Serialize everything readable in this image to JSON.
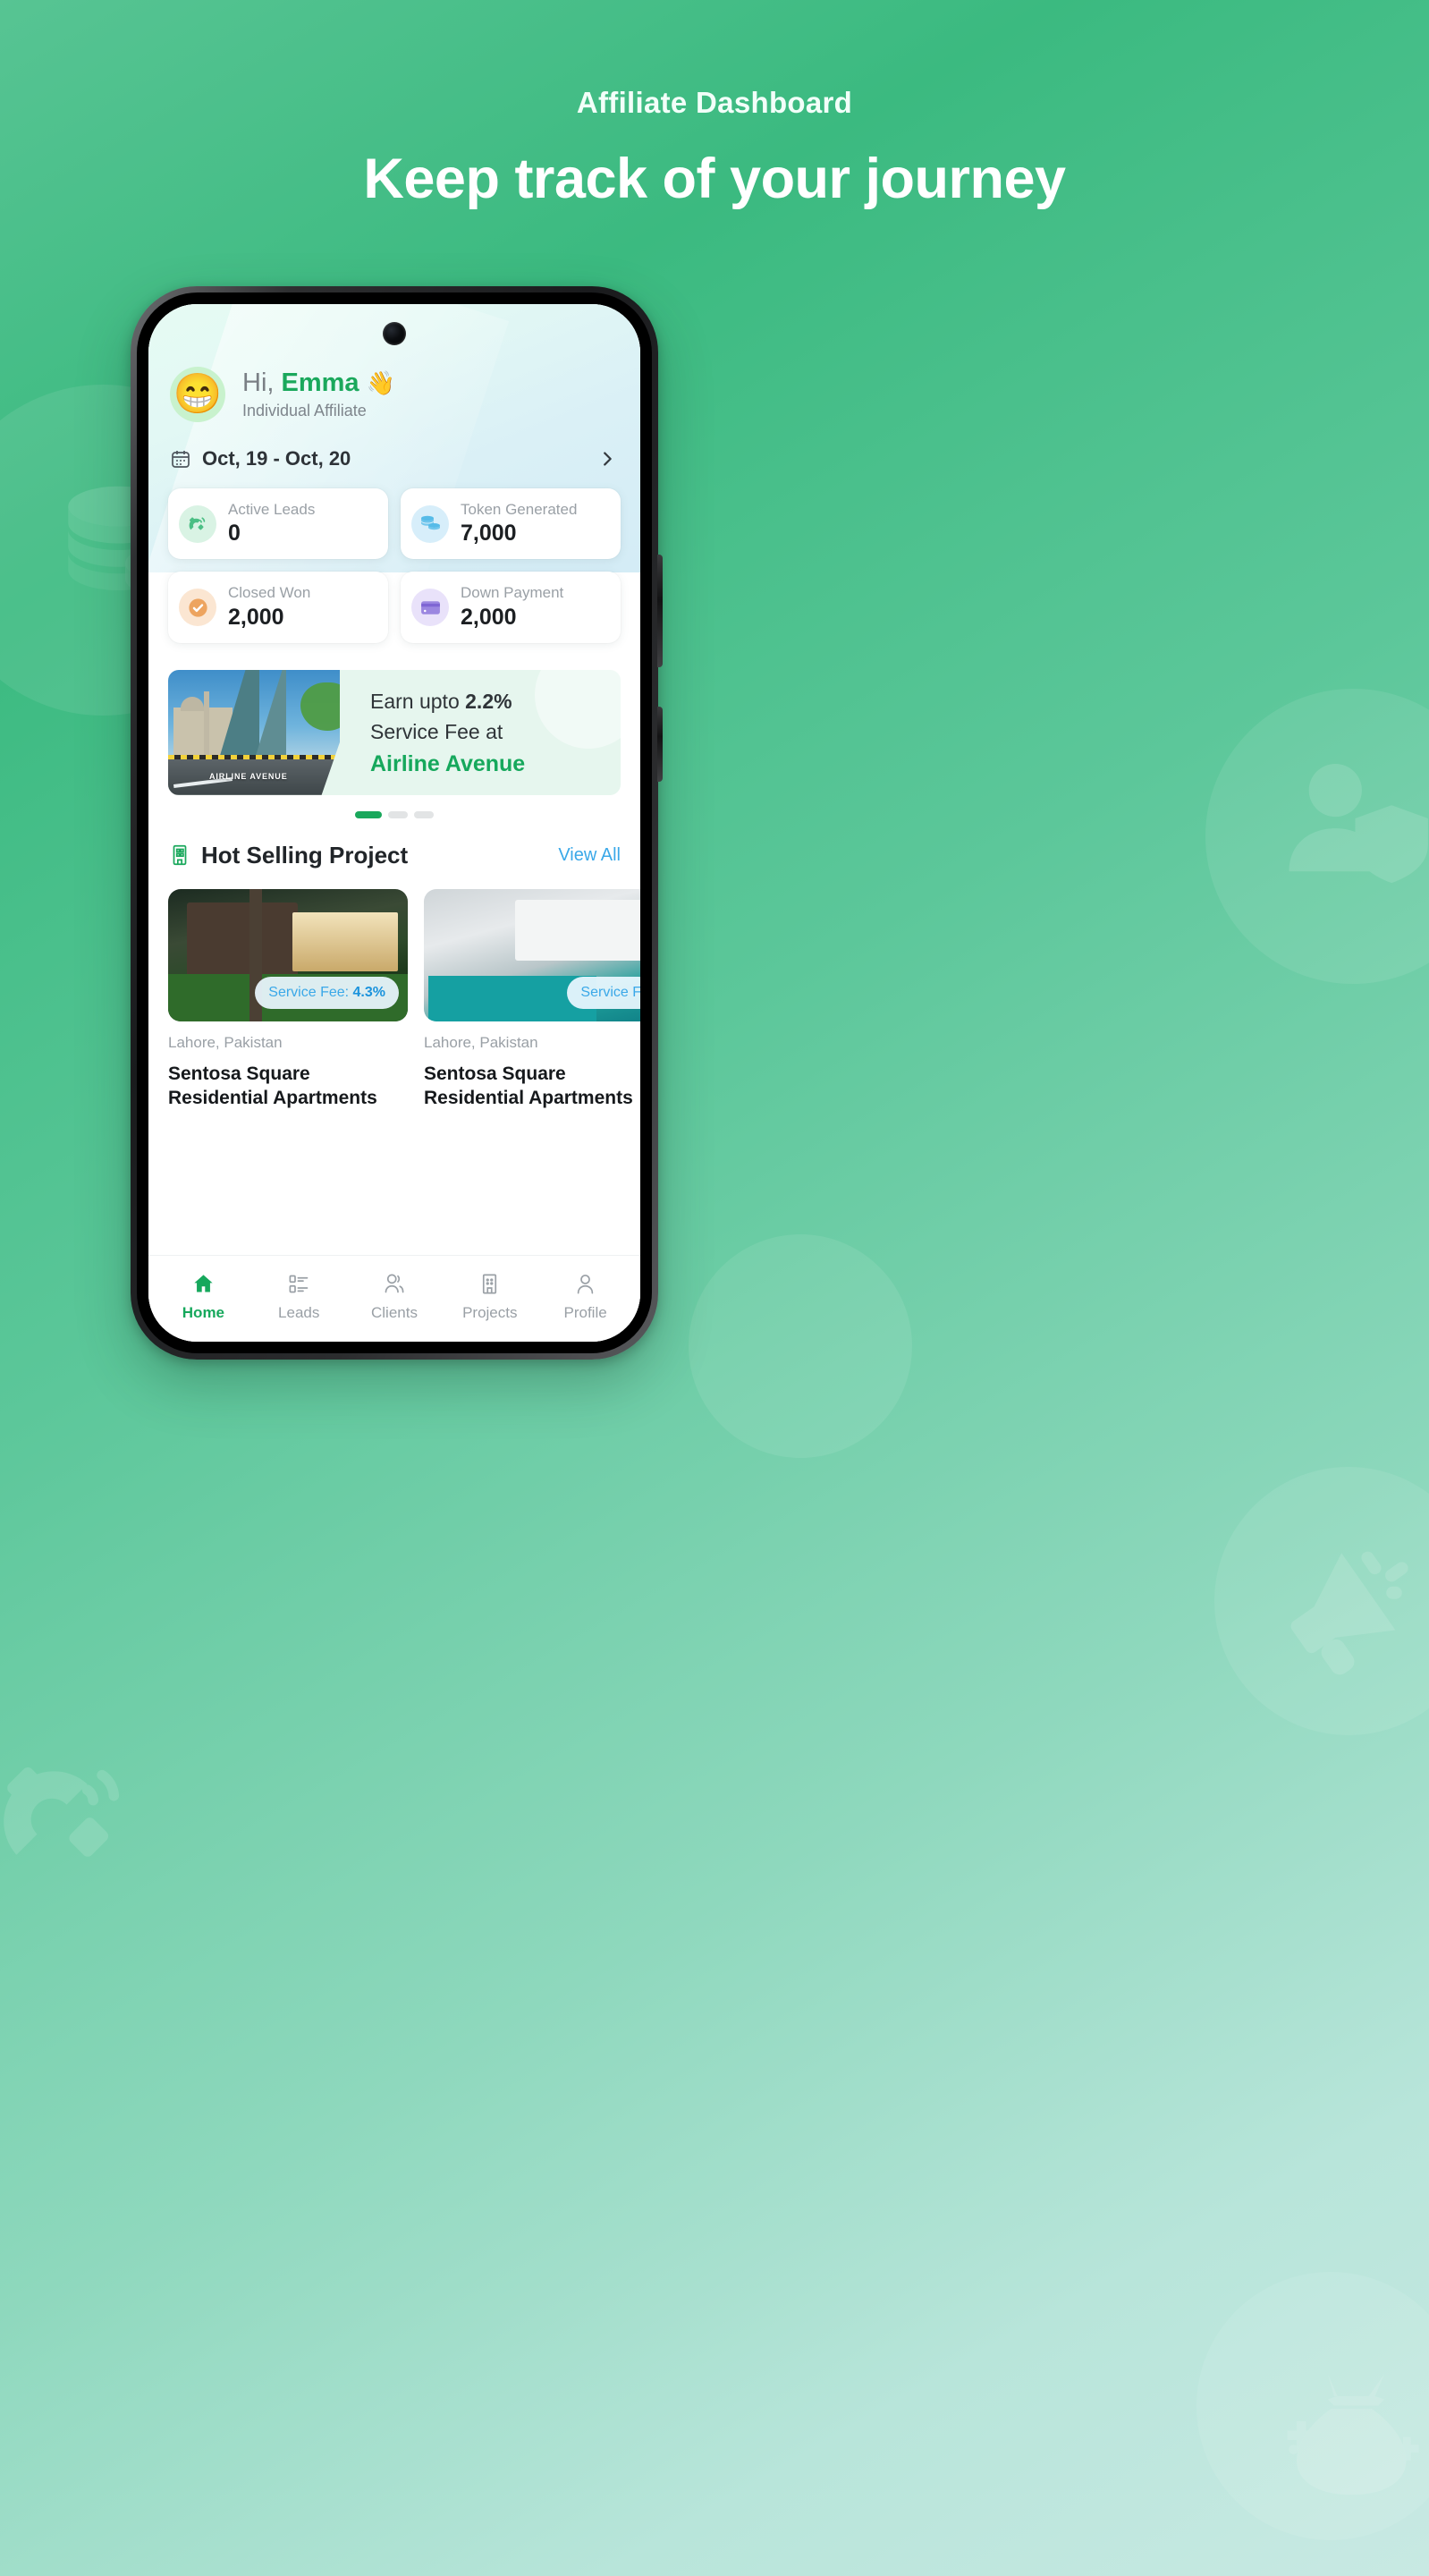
{
  "promo_header": {
    "eyebrow": "Affiliate Dashboard",
    "headline": "Keep track of your journey"
  },
  "app": {
    "profile": {
      "greeting_prefix": "Hi, ",
      "name": "Emma",
      "wave_emoji": "👋",
      "avatar_emoji": "😁",
      "role": "Individual Affiliate"
    },
    "date_filter": {
      "icon": "calendar-icon",
      "range": "Oct, 19 - Oct, 20",
      "chevron": "chevron-right-icon"
    },
    "stats": [
      {
        "label": "Active Leads",
        "value": "0",
        "icon": "magnet-icon",
        "icon_bg": "#d9f3e4",
        "icon_color": "#4cbf85"
      },
      {
        "label": "Token Generated",
        "value": "7,000",
        "icon": "coins-icon",
        "icon_bg": "#d7eefa",
        "icon_color": "#56bbe8"
      },
      {
        "label": "Closed Won",
        "value": "2,000",
        "icon": "check-circle-icon",
        "icon_bg": "#fbe6d2",
        "icon_color": "#eda45f"
      },
      {
        "label": "Down Payment",
        "value": "2,000",
        "icon": "credit-card-icon",
        "icon_bg": "#e9e2fa",
        "icon_color": "#9b87e0"
      }
    ],
    "promo_banner": {
      "line1_prefix": "Earn upto ",
      "line1_value": "2.2%",
      "line2": "Service Fee at",
      "project": "Airline Avenue",
      "image_logo": "AIRLINE AVENUE",
      "accent_color": "#16a85c"
    },
    "carousel": {
      "total": 3,
      "active_index": 0
    },
    "section": {
      "icon": "building-icon",
      "title": "Hot Selling Project",
      "view_all": "View All",
      "view_all_color": "#3aa8e8"
    },
    "projects": [
      {
        "fee_label": "Service Fee: ",
        "fee_value": "4.3%",
        "location": "Lahore, Pakistan",
        "name": "Sentosa Square Residential Apartments"
      },
      {
        "fee_label": "Service F",
        "fee_value": "",
        "location": "Lahore, Pakistan",
        "name": "Sentosa Square Residential Apartments"
      }
    ],
    "bottom_nav": {
      "active_color": "#16a85c",
      "inactive_color": "#9aa0a6",
      "items": [
        {
          "label": "Home",
          "icon": "home-icon",
          "active": true
        },
        {
          "label": "Leads",
          "icon": "list-icon",
          "active": false
        },
        {
          "label": "Clients",
          "icon": "users-icon",
          "active": false
        },
        {
          "label": "Projects",
          "icon": "building-icon",
          "active": false
        },
        {
          "label": "Profile",
          "icon": "person-icon",
          "active": false
        }
      ]
    }
  },
  "theme": {
    "bg_top": "#57c493",
    "bg_bottom": "#c8e9e3",
    "brand_green": "#16a85c"
  }
}
